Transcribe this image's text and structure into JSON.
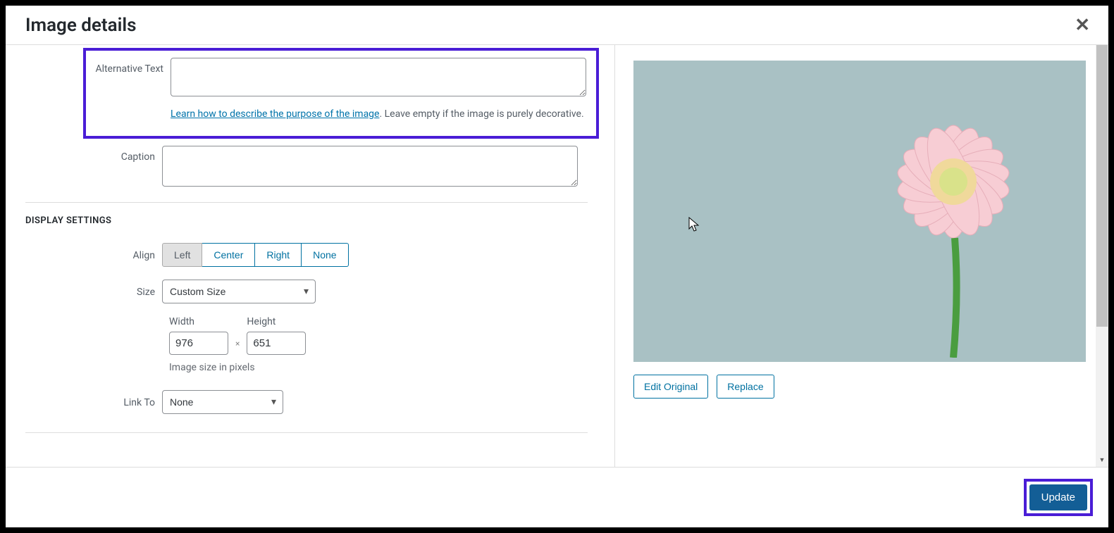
{
  "header": {
    "title": "Image details",
    "close_glyph": "✕"
  },
  "fields": {
    "alt_label": "Alternative Text",
    "alt_value": "",
    "alt_help_link": "Learn how to describe the purpose of the image",
    "alt_help_suffix": ". Leave empty if the image is purely decorative.",
    "caption_label": "Caption",
    "caption_value": ""
  },
  "display": {
    "section_title": "DISPLAY SETTINGS",
    "align_label": "Align",
    "align_options": {
      "left": "Left",
      "center": "Center",
      "right": "Right",
      "none": "None"
    },
    "size_label": "Size",
    "size_value": "Custom Size",
    "width_label": "Width",
    "width_value": "976",
    "height_label": "Height",
    "height_value": "651",
    "times_glyph": "×",
    "size_help": "Image size in pixels",
    "linkto_label": "Link To",
    "linkto_value": "None"
  },
  "preview": {
    "edit_label": "Edit Original",
    "replace_label": "Replace"
  },
  "footer": {
    "update_label": "Update"
  }
}
